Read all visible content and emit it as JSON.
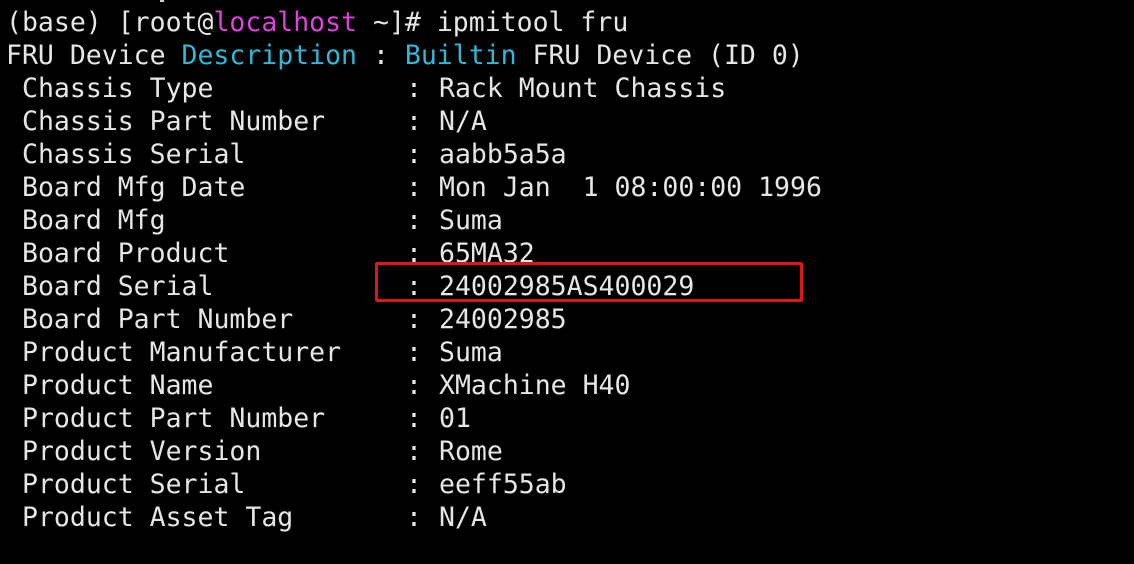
{
  "terminal": {
    "prompt": {
      "env": "(base) ",
      "open_bracket": "[",
      "user": "root",
      "at": "@",
      "host": "localhost",
      "path": " ~",
      "close": "]# ",
      "command": "ipmitool fru"
    },
    "header": {
      "part1": "FRU Device ",
      "part2": "Description",
      "part3": " : ",
      "part4": "Builtin",
      "part5": " FRU Device (ID 0)"
    },
    "separator": ":",
    "fields": [
      {
        "label": "Chassis Type",
        "value": "Rack Mount Chassis"
      },
      {
        "label": "Chassis Part Number",
        "value": "N/A"
      },
      {
        "label": "Chassis Serial",
        "value": "aabb5a5a"
      },
      {
        "label": "Board Mfg Date",
        "value": "Mon Jan  1 08:00:00 1996"
      },
      {
        "label": "Board Mfg",
        "value": "Suma"
      },
      {
        "label": "Board Product",
        "value": "65MA32"
      },
      {
        "label": "Board Serial",
        "value": "24002985AS400029"
      },
      {
        "label": "Board Part Number",
        "value": "24002985"
      },
      {
        "label": "Product Manufacturer",
        "value": "Suma"
      },
      {
        "label": "Product Name",
        "value": "XMachine H40"
      },
      {
        "label": "Product Part Number",
        "value": "01"
      },
      {
        "label": "Product Version",
        "value": "Rome"
      },
      {
        "label": "Product Serial",
        "value": "eeff55ab"
      },
      {
        "label": "Product Asset Tag",
        "value": "N/A"
      }
    ],
    "colors": {
      "background": "#000000",
      "text": "#e6e6e6",
      "host_highlight": "#e040e0",
      "keyword_highlight": "#2fb8d8",
      "annotation_box": "#e0141c"
    }
  }
}
